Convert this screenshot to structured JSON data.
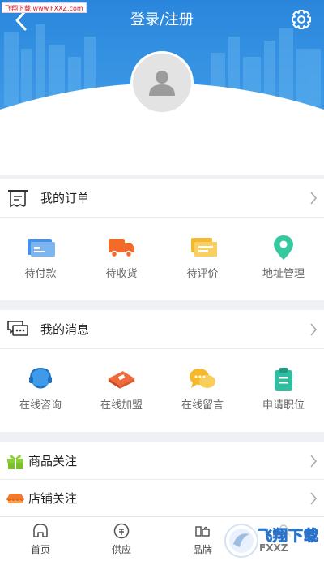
{
  "watermark_top": "飞翔下载 www.FXXZ.com",
  "header": {
    "title": "登录/注册"
  },
  "orders": {
    "title": "我的订单",
    "items": [
      {
        "label": "待付款",
        "icon": "wallet-card-icon"
      },
      {
        "label": "待收货",
        "icon": "delivery-truck-icon"
      },
      {
        "label": "待评价",
        "icon": "review-chat-icon"
      },
      {
        "label": "地址管理",
        "icon": "location-pin-icon"
      }
    ]
  },
  "messages": {
    "title": "我的消息",
    "items": [
      {
        "label": "在线咨询",
        "icon": "headset-icon"
      },
      {
        "label": "在线加盟",
        "icon": "join-box-icon"
      },
      {
        "label": "在线留言",
        "icon": "message-bubbles-icon"
      },
      {
        "label": "申请职位",
        "icon": "clipboard-icon"
      }
    ]
  },
  "lists": [
    {
      "label": "商品关注",
      "icon": "gift-icon"
    },
    {
      "label": "店铺关注",
      "icon": "shop-awning-icon"
    }
  ],
  "bottom_nav": [
    {
      "label": "首页",
      "icon": "home-icon"
    },
    {
      "label": "供应",
      "icon": "supply-icon"
    },
    {
      "label": "品牌",
      "icon": "brand-icon"
    },
    {
      "label": "",
      "icon": "mine-icon"
    }
  ],
  "watermark_bottom": {
    "title": "飞翔下载",
    "sub": "FXXZ"
  },
  "colors": {
    "header_blue": "#2e8be0",
    "wallet": "#4a90e2",
    "truck": "#f36a2a",
    "review": "#f5b82e",
    "pin": "#36c9a0",
    "headset": "#3d9be9",
    "box": "#f06a3c",
    "bubbles": "#f6b92b",
    "clipboard": "#2fbfa0",
    "gift": "#8ccf3a",
    "shop": "#f07a2e"
  }
}
